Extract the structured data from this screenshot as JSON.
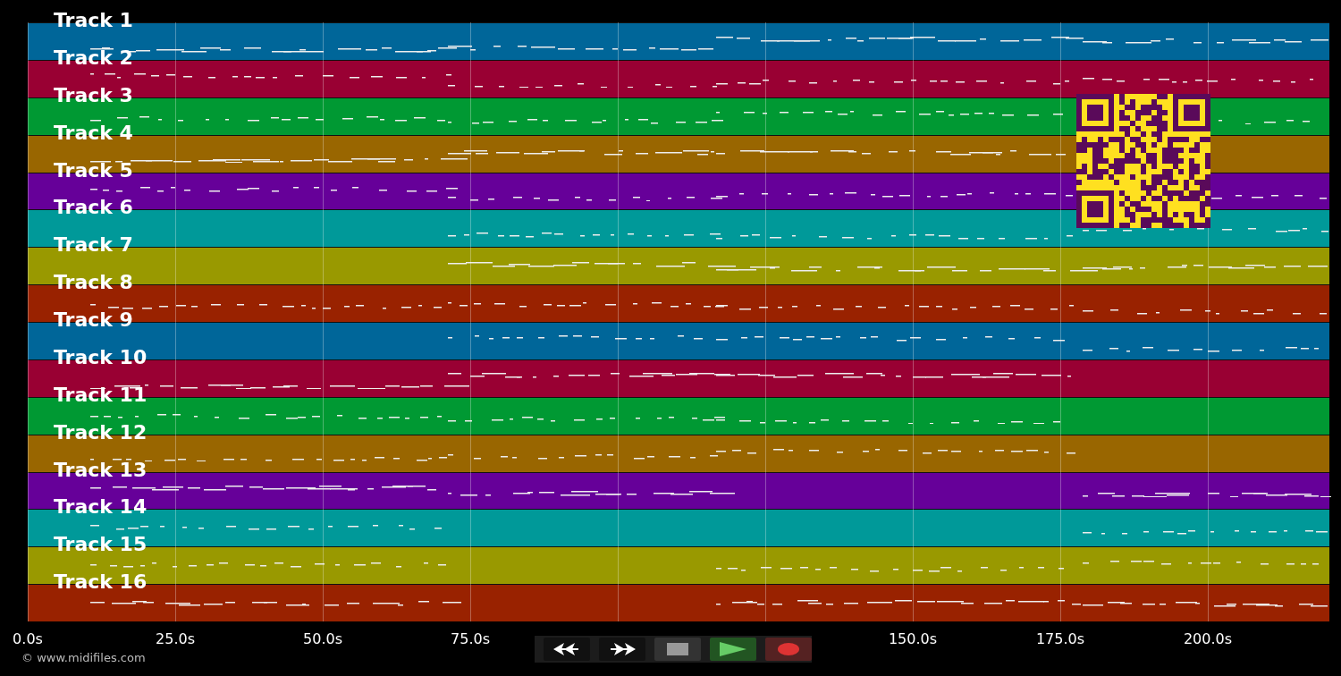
{
  "tracks": [
    {
      "name": "Track 1",
      "color": "#006699"
    },
    {
      "name": "Track 2",
      "color": "#990033"
    },
    {
      "name": "Track 3",
      "color": "#009933"
    },
    {
      "name": "Track 4",
      "color": "#996600"
    },
    {
      "name": "Track 5",
      "color": "#660099"
    },
    {
      "name": "Track 6",
      "color": "#009999"
    },
    {
      "name": "Track 7",
      "color": "#999900"
    },
    {
      "name": "Track 8",
      "color": "#992200"
    },
    {
      "name": "Track 9",
      "color": "#006699"
    },
    {
      "name": "Track 10",
      "color": "#990033"
    },
    {
      "name": "Track 11",
      "color": "#009933"
    },
    {
      "name": "Track 12",
      "color": "#996600"
    },
    {
      "name": "Track 13",
      "color": "#660099"
    },
    {
      "name": "Track 14",
      "color": "#009999"
    },
    {
      "name": "Track 15",
      "color": "#999900"
    },
    {
      "name": "Track 16",
      "color": "#992200"
    }
  ],
  "time_axis": [
    {
      "kind": "label",
      "label": "0.0s"
    },
    {
      "kind": "label",
      "label": "25.0s"
    },
    {
      "kind": "label",
      "label": "50.0s"
    },
    {
      "kind": "label",
      "label": "75.0s"
    },
    {
      "kind": "covered"
    },
    {
      "kind": "covered"
    },
    {
      "kind": "label",
      "label": "150.0s"
    },
    {
      "kind": "label",
      "label": "175.0s"
    },
    {
      "kind": "label",
      "label": "200.0s"
    }
  ],
  "transport": [
    {
      "kind": "rewind"
    },
    {
      "kind": "forward"
    },
    {
      "kind": "stop"
    },
    {
      "kind": "play"
    },
    {
      "kind": "record"
    }
  ],
  "copyright": "© www.midifiles.com"
}
